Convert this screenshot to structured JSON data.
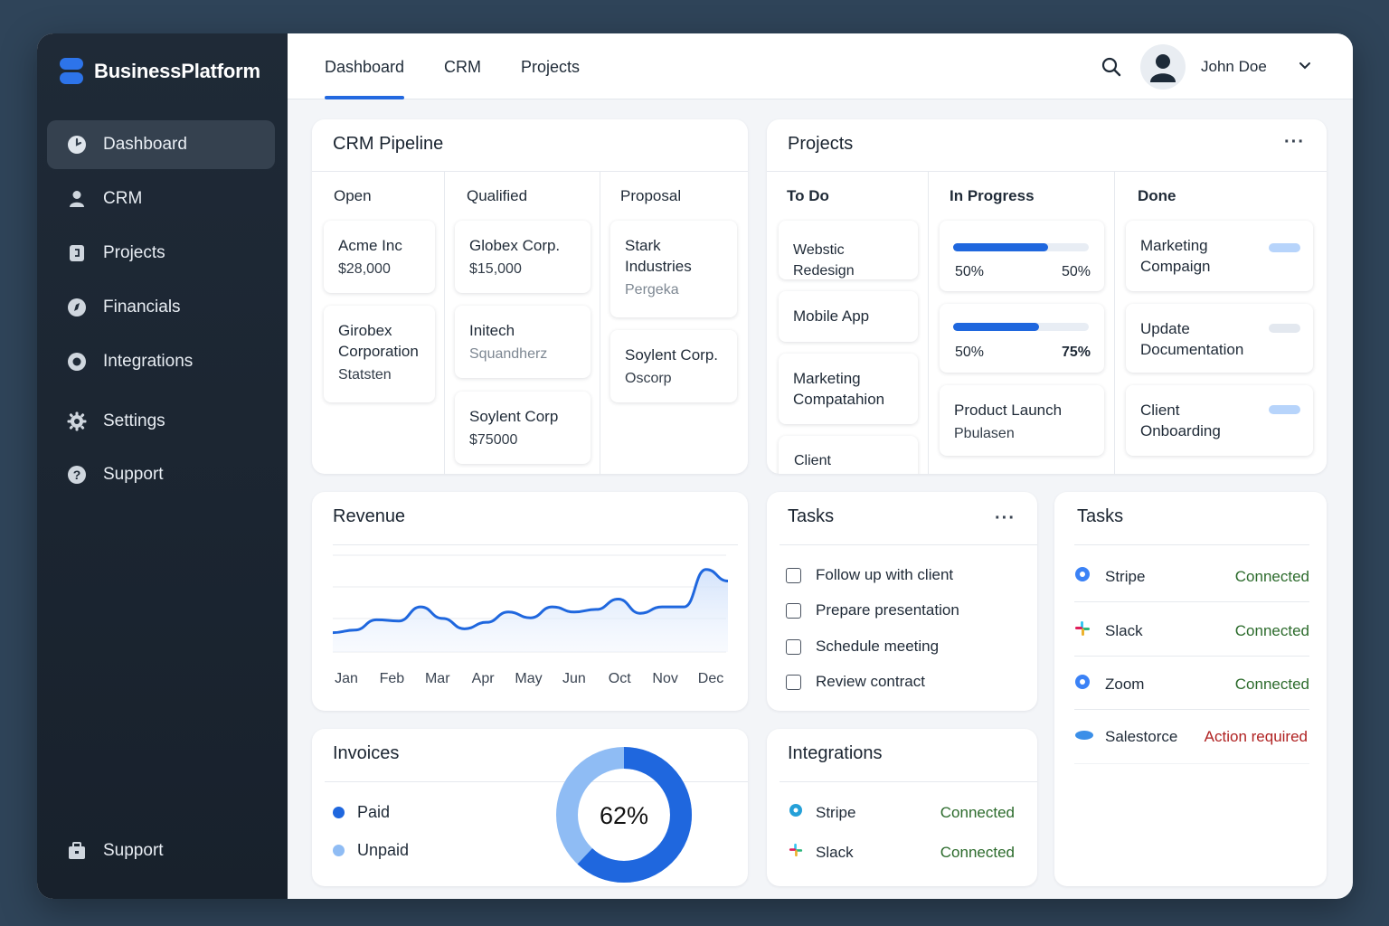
{
  "brand": {
    "name": "BusinessPlatform",
    "color": "#2d74ea"
  },
  "sidebar": {
    "items": [
      {
        "label": "Dashboard",
        "icon": "dashboard-icon",
        "active": true
      },
      {
        "label": "CRM",
        "icon": "user-icon"
      },
      {
        "label": "Projects",
        "icon": "document-icon"
      },
      {
        "label": "Financials",
        "icon": "compass-icon"
      },
      {
        "label": "Integrations",
        "icon": "ring-icon"
      },
      {
        "label": "Settings",
        "icon": "gear-icon"
      },
      {
        "label": "Support",
        "icon": "help-icon"
      }
    ],
    "footer": {
      "label": "Support",
      "icon": "briefcase-icon"
    }
  },
  "header": {
    "tabs": [
      {
        "label": "Dashboard",
        "active": true
      },
      {
        "label": "CRM"
      },
      {
        "label": "Projects"
      }
    ],
    "user_name": "John Doe"
  },
  "crm_pipeline": {
    "title": "CRM Pipeline",
    "columns": [
      {
        "name": "Open",
        "cards": [
          {
            "title": "Acme Inc",
            "sub": "$28,000"
          },
          {
            "title": "Girobex Corporation",
            "sub": "Statsten"
          }
        ]
      },
      {
        "name": "Qualified",
        "cards": [
          {
            "title": "Globex Corp.",
            "sub": "$15,000"
          },
          {
            "title": "Initech",
            "sub": "Squandherz"
          },
          {
            "title": "Soylent Corp",
            "sub": "$75000"
          }
        ]
      },
      {
        "name": "Proposal",
        "cards": [
          {
            "title": "Stark Industries",
            "sub": "Pergeka"
          },
          {
            "title": "Soylent Corp.",
            "sub": "Oscorp"
          }
        ]
      }
    ]
  },
  "projects": {
    "title": "Projects",
    "columns": {
      "todo": {
        "name": "To Do",
        "cards": [
          "Webstic Redesign",
          "Mobile App",
          "Marketing Compatahion",
          "Client Onboarding"
        ]
      },
      "in_progress": {
        "name": "In Progress",
        "cards": [
          {
            "progress": 0.7,
            "left": "50%",
            "right": "50%"
          },
          {
            "progress": 0.63,
            "left": "50%",
            "right": "75%"
          },
          {
            "title": "Product Launch",
            "sub": "Pbulasen"
          }
        ]
      },
      "done": {
        "name": "Done",
        "cards": [
          {
            "title": "Marketing Compaign",
            "pill_color": "#b7d4fb"
          },
          {
            "title": "Update Documentation",
            "pill_color": "#e3e8ef"
          },
          {
            "title": "Client Onboarding",
            "pill_color": "#b7d4fb"
          }
        ]
      }
    }
  },
  "revenue": {
    "title": "Revenue"
  },
  "chart_data": {
    "type": "area",
    "title": "Revenue",
    "categories": [
      "Jan",
      "Feb",
      "Mar",
      "Apr",
      "May",
      "Jun",
      "Oct",
      "Nov",
      "Dec"
    ],
    "values": [
      30,
      34,
      50,
      48,
      70,
      52,
      36,
      46,
      62,
      53,
      70,
      62,
      66,
      82,
      60,
      70,
      70,
      128,
      110
    ],
    "ylim": [
      0,
      150
    ],
    "grid": true,
    "color": "#1f67de"
  },
  "tasks_center": {
    "title": "Tasks",
    "items": [
      "Follow up with client",
      "Prepare presentation",
      "Schedule meeting",
      "Review contract"
    ]
  },
  "tasks_right": {
    "title": "Tasks",
    "items": [
      {
        "name": "Stripe",
        "status": "Connected",
        "icon": "stripe-icon"
      },
      {
        "name": "Slack",
        "status": "Connected",
        "icon": "slack-icon"
      },
      {
        "name": "Zoom",
        "status": "Connected",
        "icon": "zoom-icon"
      },
      {
        "name": "Salestorce",
        "status": "Action required",
        "icon": "salesforce-icon"
      }
    ]
  },
  "invoices": {
    "title": "Invoices",
    "legend": [
      {
        "label": "Paid",
        "color": "#1f67de"
      },
      {
        "label": "Unpaid",
        "color": "#8fbcf4"
      }
    ],
    "percent_label": "62%",
    "paid_fraction": 0.62
  },
  "integrations": {
    "title": "Integrations",
    "items": [
      {
        "name": "Stripe",
        "status": "Connected"
      },
      {
        "name": "Slack",
        "status": "Connected"
      }
    ]
  }
}
